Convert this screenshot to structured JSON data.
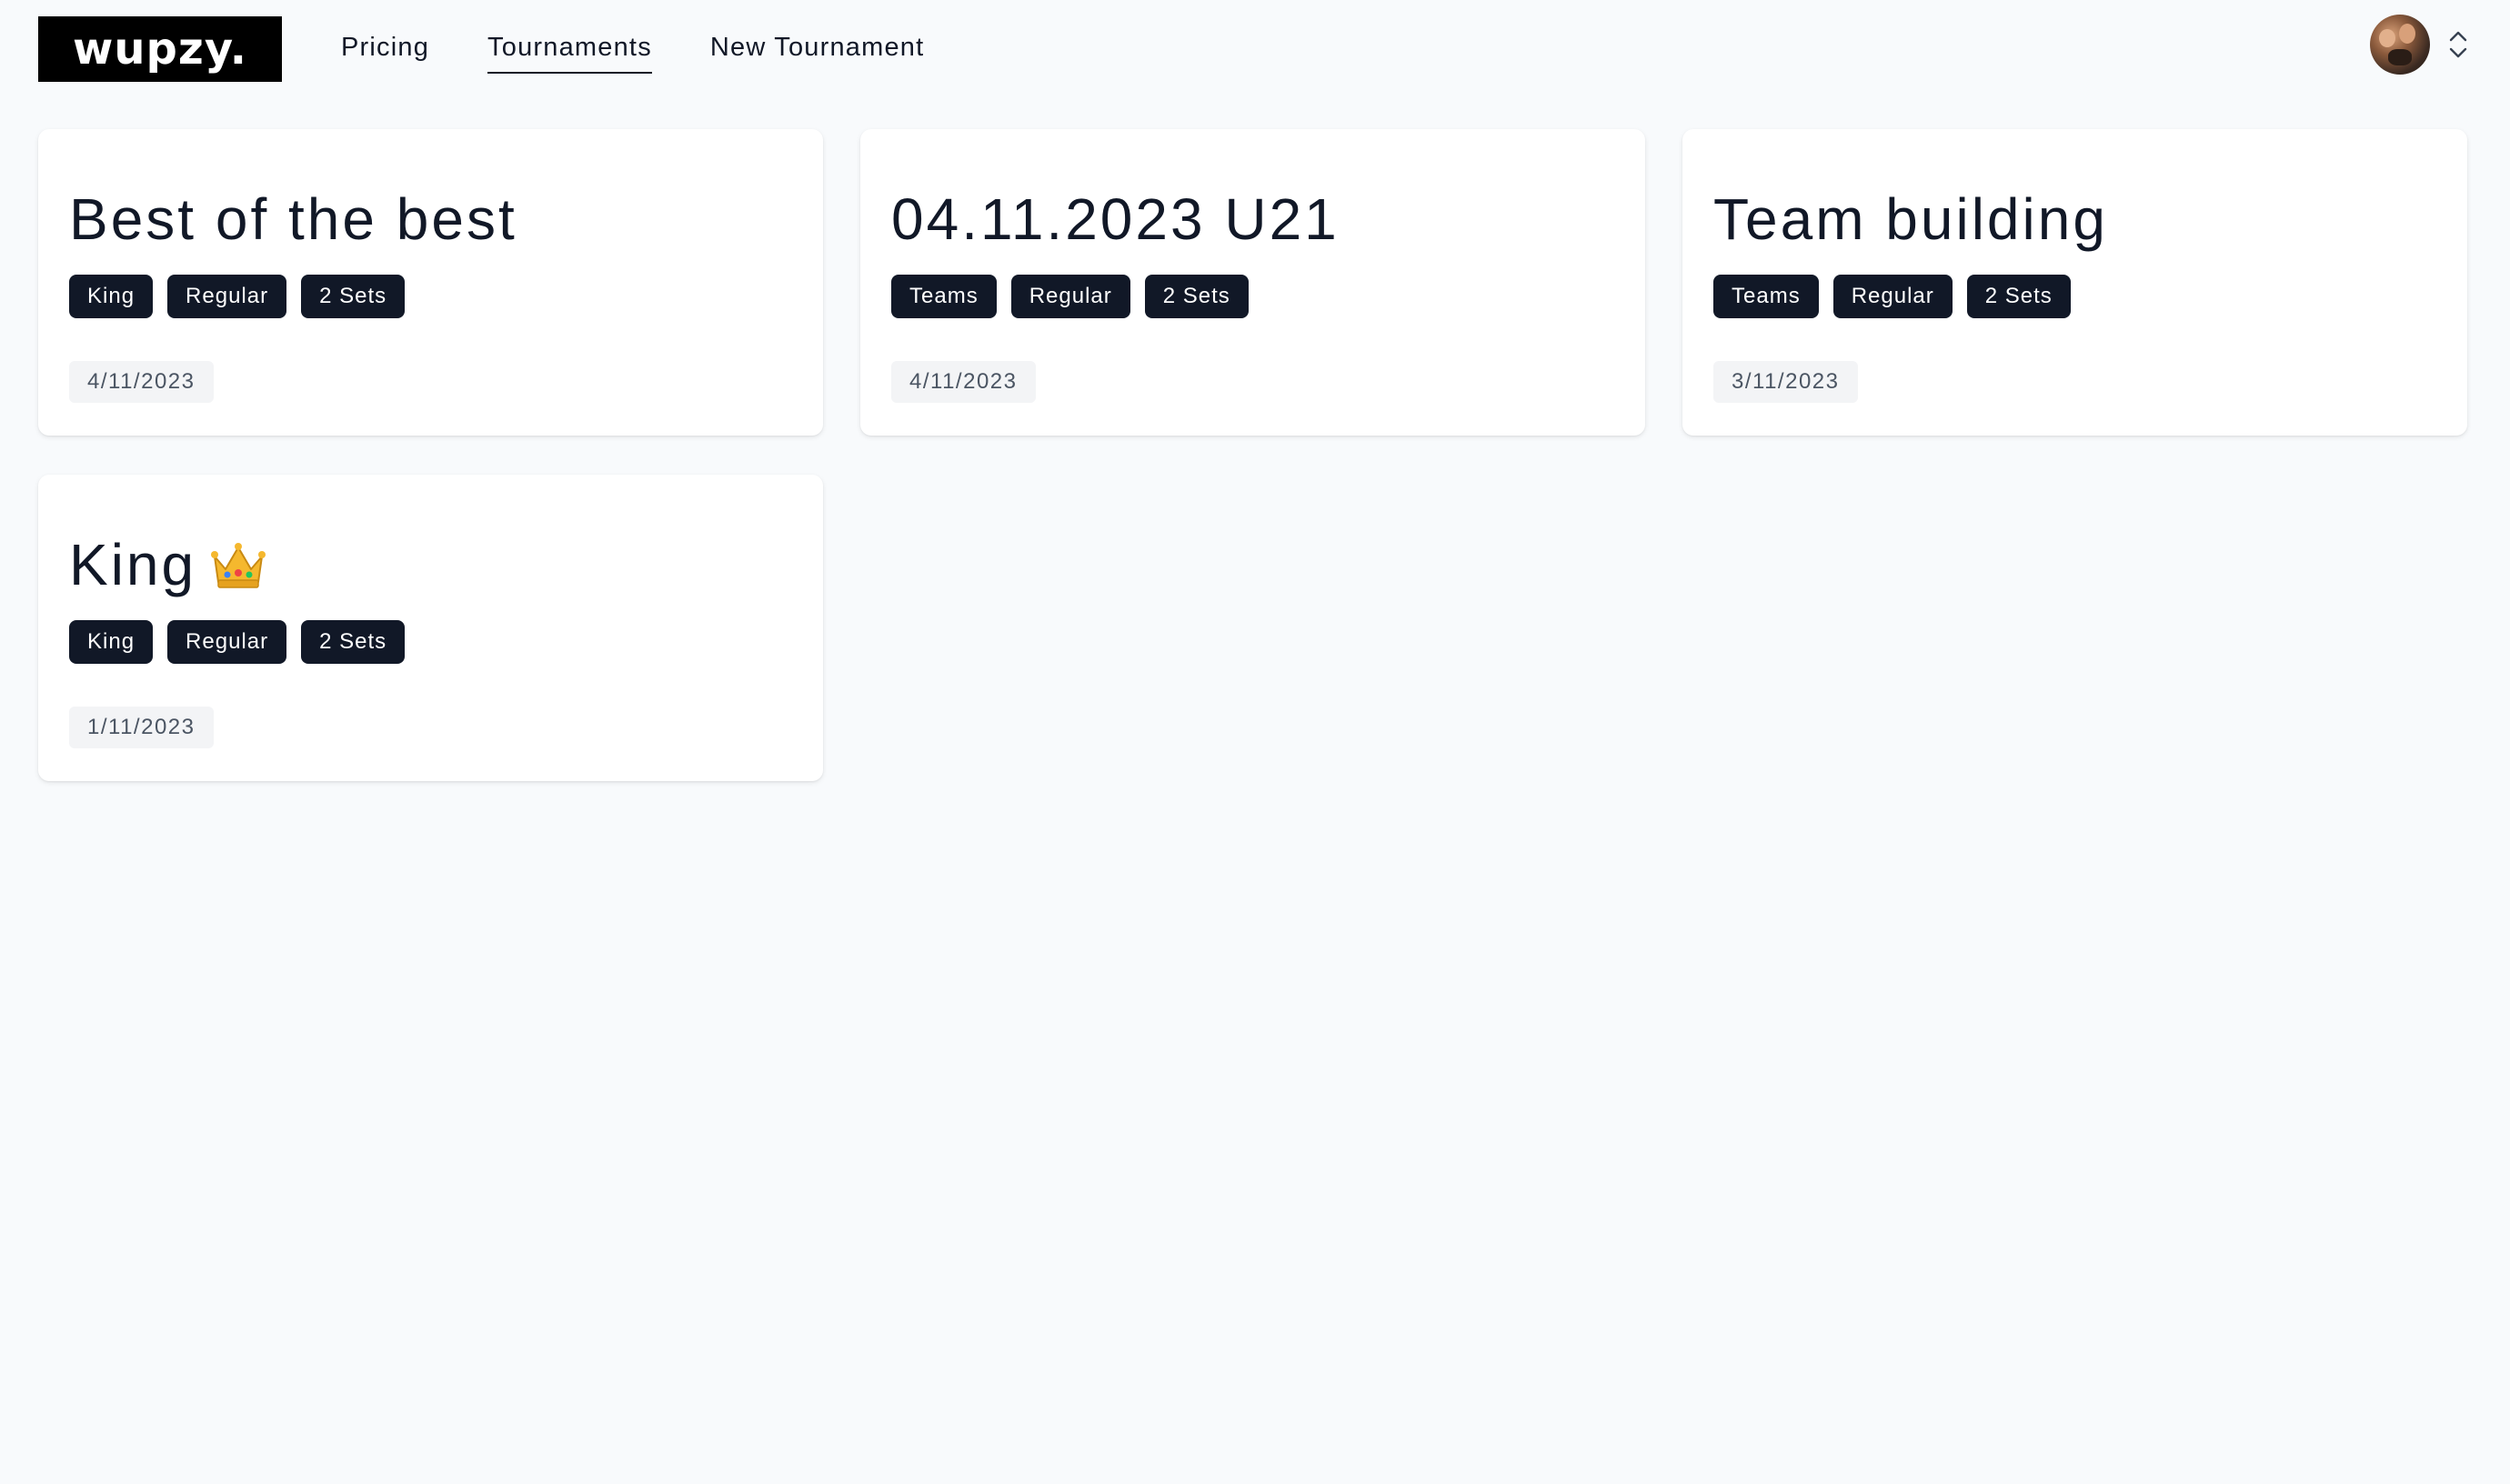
{
  "app": {
    "logo_text": "wupzy."
  },
  "nav": {
    "items": [
      {
        "label": "Pricing",
        "active": false
      },
      {
        "label": "Tournaments",
        "active": true
      },
      {
        "label": "New Tournament",
        "active": false
      }
    ]
  },
  "user_menu": {
    "avatar_icon": "user-avatar",
    "toggle_icon": "chevron-up-down-icon"
  },
  "tournaments": [
    {
      "title": "Best of the best",
      "emoji": "",
      "tags": [
        "King",
        "Regular",
        "2 Sets"
      ],
      "date": "4/11/2023"
    },
    {
      "title": "04.11.2023 U21",
      "emoji": "",
      "tags": [
        "Teams",
        "Regular",
        "2 Sets"
      ],
      "date": "4/11/2023"
    },
    {
      "title": "Team building",
      "emoji": "",
      "tags": [
        "Teams",
        "Regular",
        "2 Sets"
      ],
      "date": "3/11/2023"
    },
    {
      "title": "King",
      "emoji": "👑",
      "tags": [
        "King",
        "Regular",
        "2 Sets"
      ],
      "date": "1/11/2023"
    }
  ],
  "colors": {
    "background": "#f8fafc",
    "chip": "#111827",
    "date_badge": "#f3f4f6",
    "logo_bg": "#000000"
  }
}
